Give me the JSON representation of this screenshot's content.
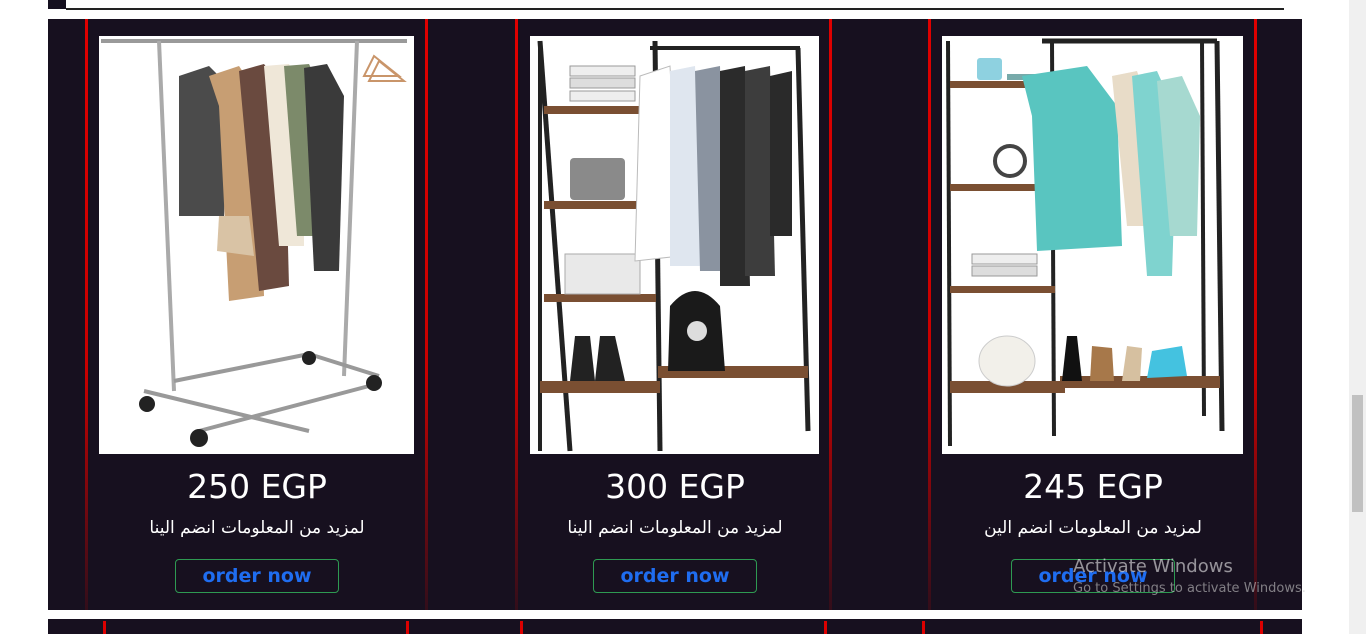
{
  "products": [
    {
      "price": "250 EGP",
      "description": "لمزيد من المعلومات انضم الينا",
      "button": "order now",
      "image": "folding-garment-rack-image"
    },
    {
      "price": "300 EGP",
      "description": "لمزيد من المعلومات انضم الينا",
      "button": "order now",
      "image": "shelf-clothing-rack-image"
    },
    {
      "price": "245 EGP",
      "description": "لمزيد من المعلومات انضم الين",
      "button": "order now",
      "image": "open-wardrobe-rack-image"
    }
  ],
  "watermark": {
    "title": "Activate Windows",
    "subtitle": "Go to Settings to activate Windows."
  },
  "colors": {
    "section_bg": "#17101f",
    "card_border": "#e00000",
    "button_border": "#2e9a52",
    "button_text": "#1f6df0"
  }
}
